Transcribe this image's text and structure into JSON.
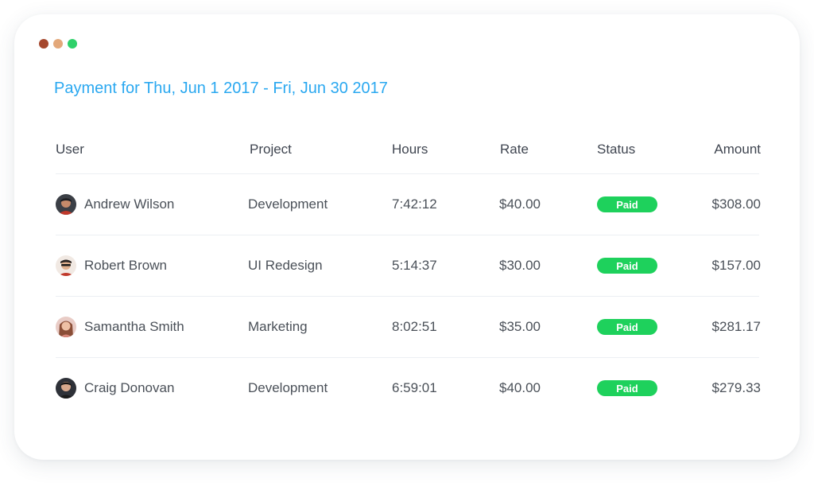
{
  "window": {
    "dot_colors": [
      "#a5472d",
      "#e3a87a",
      "#2fd16a"
    ]
  },
  "header": {
    "title": "Payment for Thu, Jun 1 2017 - Fri, Jun 30 2017"
  },
  "table": {
    "columns": {
      "user": "User",
      "project": "Project",
      "hours": "Hours",
      "rate": "Rate",
      "status": "Status",
      "amount": "Amount"
    },
    "rows": [
      {
        "user": "Andrew Wilson",
        "project": "Development",
        "hours": "7:42:12",
        "rate": "$40.00",
        "status": "Paid",
        "amount": "$308.00",
        "avatar_icon": "avatar-andrew-icon"
      },
      {
        "user": "Robert Brown",
        "project": "UI Redesign",
        "hours": "5:14:37",
        "rate": "$30.00",
        "status": "Paid",
        "amount": "$157.00",
        "avatar_icon": "avatar-robert-icon"
      },
      {
        "user": "Samantha Smith",
        "project": "Marketing",
        "hours": "8:02:51",
        "rate": "$35.00",
        "status": "Paid",
        "amount": "$281.17",
        "avatar_icon": "avatar-samantha-icon"
      },
      {
        "user": "Craig Donovan",
        "project": "Development",
        "hours": "6:59:01",
        "rate": "$40.00",
        "status": "Paid",
        "amount": "$279.33",
        "avatar_icon": "avatar-craig-icon"
      }
    ]
  },
  "colors": {
    "title": "#2aa8f0",
    "paid_badge": "#1ed15c",
    "divider": "#eceff3"
  }
}
